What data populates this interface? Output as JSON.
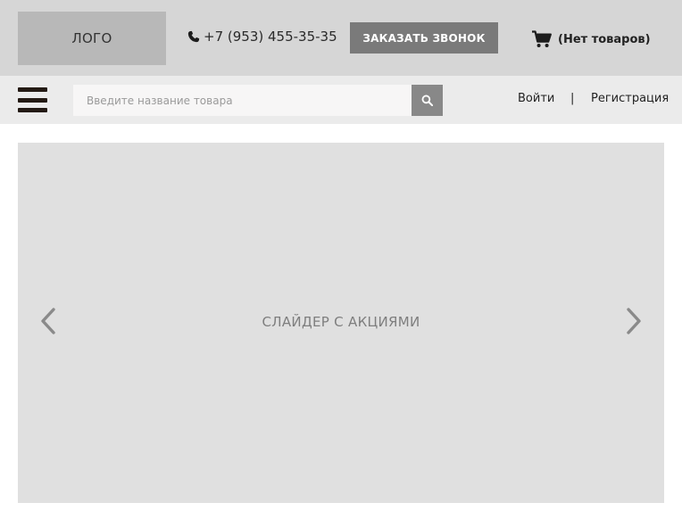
{
  "header": {
    "logo_text": "ЛОГО",
    "phone": "+7 (953) 455-35-35",
    "callback_label": "ЗАКАЗАТЬ ЗВОНОК",
    "cart_label": "(Нет товаров)"
  },
  "nav": {
    "menu_icon": "hamburger-icon",
    "search_placeholder": "Введите название товара",
    "search_value": "",
    "login_label": "Войти",
    "separator": "|",
    "register_label": "Регистрация"
  },
  "slider": {
    "text": "СЛАЙДЕР С АКЦИЯМИ",
    "prev_icon": "chevron-left-icon",
    "next_icon": "chevron-right-icon"
  },
  "colors": {
    "topbar_bg": "#d6d6d6",
    "navbar_bg": "#ebebeb",
    "button_bg": "#7a7a7a",
    "slider_bg": "#e0e0e0"
  }
}
